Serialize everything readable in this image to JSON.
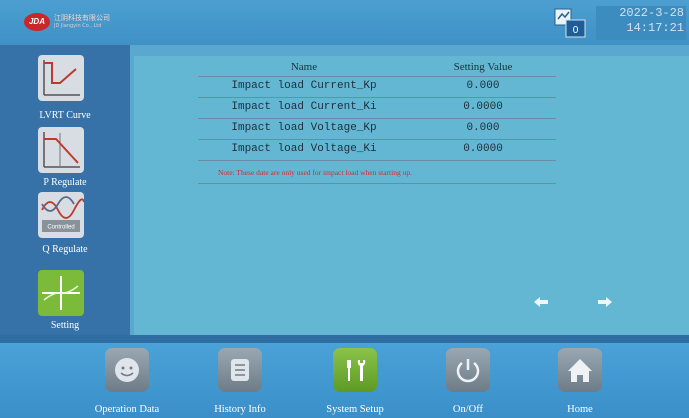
{
  "header": {
    "logo_text": "JDA",
    "company_cn": "江阴科技有限公司",
    "company_en": "JD Jiangyin Co., Ltd",
    "connection_badge": "0",
    "date": "2022-3-28",
    "time": "14:17:21"
  },
  "sidebar": {
    "items": [
      {
        "label": "LVRT Curve",
        "icon": "lvrt-curve-icon"
      },
      {
        "label": "P Regulate",
        "icon": "p-regulate-icon"
      },
      {
        "label": "Q Regulate",
        "icon": "q-regulate-icon",
        "icon_text": "Controlled"
      },
      {
        "label": "Setting",
        "icon": "setting-icon",
        "active": true
      }
    ]
  },
  "table": {
    "header_name": "Name",
    "header_value": "Setting Value",
    "rows": [
      {
        "name": "Impact load Current_Kp",
        "value": "0.000"
      },
      {
        "name": "Impact load Current_Ki",
        "value": "0.0000"
      },
      {
        "name": "Impact load Voltage_Kp",
        "value": "0.000"
      },
      {
        "name": "Impact load Voltage_Ki",
        "value": "0.0000"
      }
    ],
    "note": "Note:  These date are only used for impact load when starting up."
  },
  "bottom_nav": [
    {
      "label": "Operation Data",
      "icon": "operation-data-icon"
    },
    {
      "label": "History Info",
      "icon": "history-info-icon"
    },
    {
      "label": "System Setup",
      "icon": "system-setup-icon",
      "active": true
    },
    {
      "label": "On/Off",
      "icon": "power-icon"
    },
    {
      "label": "Home",
      "icon": "home-icon"
    }
  ],
  "colors": {
    "accent_green": "#7cba3a",
    "note_red": "#d62a2a",
    "panel_blue": "#63b7d3"
  }
}
